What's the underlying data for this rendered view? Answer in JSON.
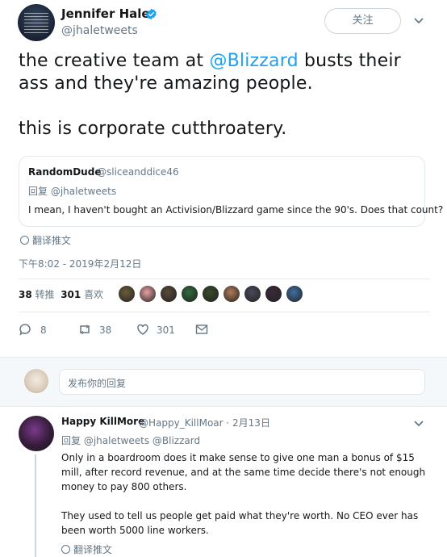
{
  "author": {
    "name": "Jennifer Hale",
    "handle": "@jhaletweets",
    "follow_label": "关注"
  },
  "tweet": {
    "text_part1": "the creative team at ",
    "mention": "@Blizzard",
    "text_part2": " busts their ass and they're amazing people.\n\nthis is corporate cutthroatery."
  },
  "quote": {
    "name": "RandomDude",
    "handle": "@sliceanddice46",
    "reply_prefix": "回复",
    "reply_to": "@jhaletweets",
    "text": "I mean, I haven't bought an Activision/Blizzard game since the 90's. Does that count?"
  },
  "translate_label": "翻译推文",
  "timestamp": "下午8:02 - 2019年2月12日",
  "stats": {
    "retweets": "38",
    "retweets_label": "转推",
    "likes": "301",
    "likes_label": "喜欢"
  },
  "liker_colors": [
    "#6b5b3a",
    "#e8a0a0",
    "#5a4a3a",
    "#2f6b3a",
    "#3a4a2a",
    "#b07a5a",
    "#4a4a5a",
    "#3a2a3a",
    "#3f6f9f"
  ],
  "actions": {
    "reply_count": "8",
    "retweet_count": "38",
    "like_count": "301"
  },
  "reply_box": {
    "placeholder": "发布你的回复"
  },
  "reply": {
    "name": "Happy KillMore",
    "handle": "@Happy_KillMoar",
    "date": "· 2月13日",
    "reply_prefix": "回复",
    "reply_to": "@jhaletweets @Blizzard",
    "paragraph1": "Only in a boardroom does it make sense to give one man a bonus of $15 mill, after record revenue, and at the same time decide there's not enough money to pay 800 others.",
    "paragraph2": "They used to tell us people get paid what they're worth.  No CEO ever has been worth 5000 line workers.",
    "translate_label": "翻译推文"
  },
  "colors": {
    "accent": "#1da1f2",
    "muted": "#657786",
    "text": "#14171a"
  }
}
